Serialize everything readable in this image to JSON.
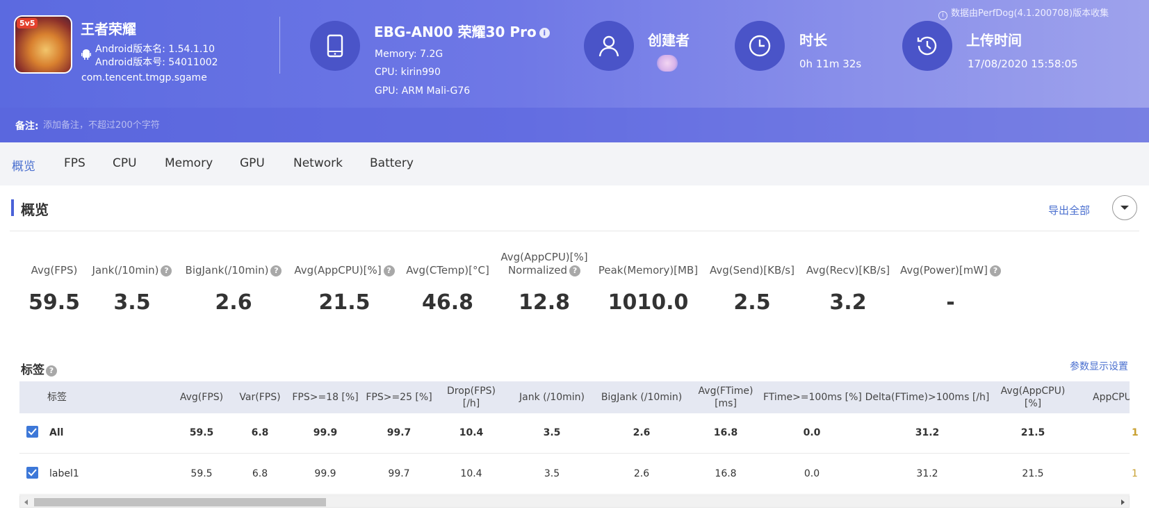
{
  "header": {
    "app": {
      "name": "王者荣耀",
      "icon_badge": "5v5",
      "version_name": "Android版本名: 1.54.1.10",
      "version_code": "Android版本号: 54011002",
      "package": "com.tencent.tmgp.sgame"
    },
    "device": {
      "title": "EBG-AN00 荣耀30 Pro",
      "memory": "Memory: 7.2G",
      "cpu": "CPU: kirin990",
      "gpu": "GPU: ARM Mali-G76"
    },
    "creator": {
      "title": "创建者"
    },
    "duration": {
      "title": "时长",
      "value": "0h 11m 32s"
    },
    "upload": {
      "title": "上传时间",
      "value": "17/08/2020 15:58:05"
    },
    "perfdog_note": "数据由PerfDog(4.1.200708)版本收集",
    "remark": {
      "label": "备注:",
      "placeholder": "添加备注，不超过200个字符"
    }
  },
  "tabs": [
    "概览",
    "FPS",
    "CPU",
    "Memory",
    "GPU",
    "Network",
    "Battery"
  ],
  "overview": {
    "title": "概览",
    "export_label": "导出全部",
    "metrics": [
      {
        "label": "Avg(FPS)",
        "value": "59.5"
      },
      {
        "label": "Jank(/10min)",
        "value": "3.5"
      },
      {
        "label": "BigJank(/10min)",
        "value": "2.6"
      },
      {
        "label": "Avg(AppCPU)[%]",
        "value": "21.5"
      },
      {
        "label": "Avg(CTemp)[°C]",
        "value": "46.8"
      },
      {
        "label": "Avg(AppCPU)[%]",
        "label2": "Normalized",
        "value": "12.8"
      },
      {
        "label": "Peak(Memory)[MB]",
        "value": "1010.0"
      },
      {
        "label": "Avg(Send)[KB/s]",
        "value": "2.5"
      },
      {
        "label": "Avg(Recv)[KB/s]",
        "value": "3.2"
      },
      {
        "label": "Avg(Power)[mW]",
        "value": "-"
      }
    ]
  },
  "tags": {
    "title": "标签",
    "param_settings": "参数显示设置",
    "columns": [
      "标签",
      "Avg(FPS)",
      "Var(FPS)",
      "FPS>=18 [%]",
      "FPS>=25 [%]",
      "Drop(FPS)",
      "[/h]",
      "Jank (/10min)",
      "BigJank (/10min)",
      "Avg(FTime)",
      "[ms]",
      "FTime>=100ms [%]",
      "Delta(FTime)>100ms [/h]",
      "Avg(AppCPU)",
      "[%]",
      "AppCPU"
    ],
    "rows": [
      {
        "label": "All",
        "values": [
          "59.5",
          "6.8",
          "99.9",
          "99.7",
          "10.4",
          "3.5",
          "2.6",
          "16.8",
          "0.0",
          "31.2",
          "21.5"
        ]
      },
      {
        "label": "label1",
        "values": [
          "59.5",
          "6.8",
          "99.9",
          "99.7",
          "10.4",
          "3.5",
          "2.6",
          "16.8",
          "0.0",
          "31.2",
          "21.5"
        ]
      }
    ],
    "clipped_cell": "1"
  }
}
